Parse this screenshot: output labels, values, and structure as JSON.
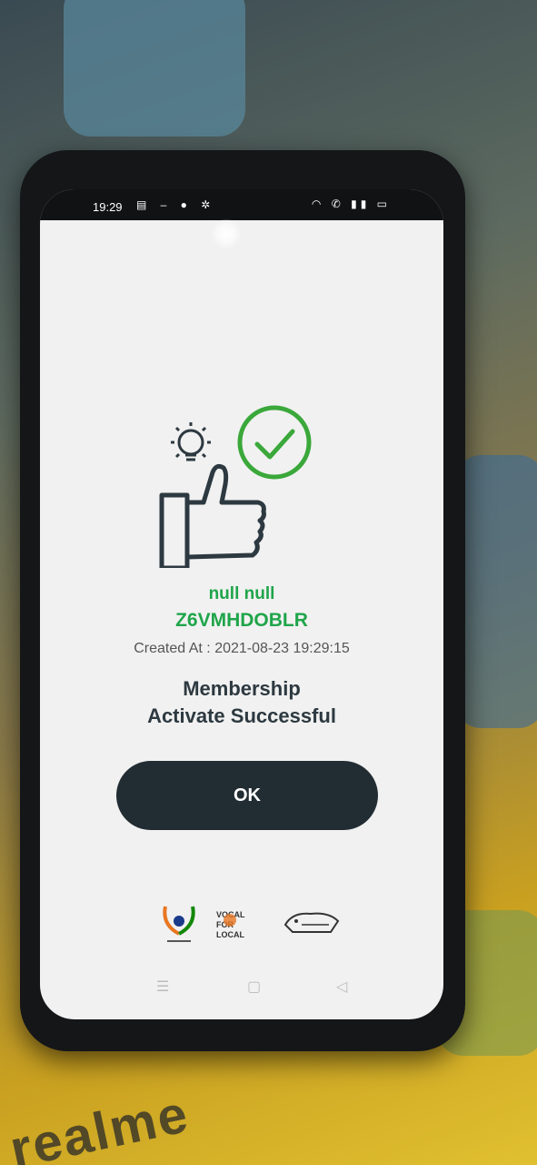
{
  "status_bar": {
    "time": "19:29"
  },
  "result": {
    "name": "null null",
    "code": "Z6VMHDOBLR",
    "created_label": "Created At :",
    "created_value": "2021-08-23 19:29:15",
    "message_line1": "Membership",
    "message_line2": "Activate Successful",
    "ok_label": "OK"
  },
  "logos": {
    "vocal_for_local": "VOCAL FOR LOCAL"
  },
  "background": {
    "brand_text": "realme"
  },
  "colors": {
    "success_green": "#1fa54a",
    "button_dark": "#222c33",
    "heading": "#2d3940"
  },
  "icons": [
    "lightbulb-icon",
    "thumbs-up-icon",
    "check-circle-icon",
    "wifi-icon",
    "battery-icon",
    "menu-icon",
    "home-icon",
    "back-icon"
  ]
}
